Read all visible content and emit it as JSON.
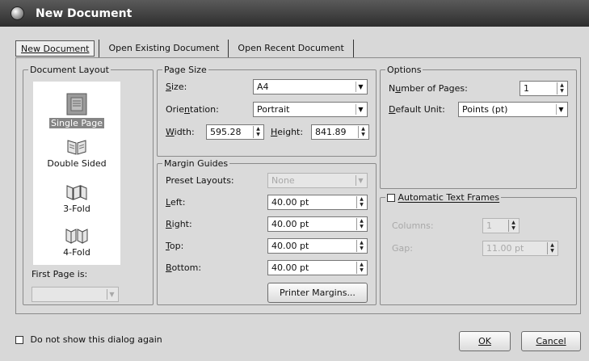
{
  "window": {
    "title": "New Document"
  },
  "tabs": [
    {
      "label": "New Document"
    },
    {
      "label": "Open Existing Document"
    },
    {
      "label": "Open Recent Document"
    }
  ],
  "document_layout": {
    "legend": "Document Layout",
    "items": [
      {
        "label": "Single Page"
      },
      {
        "label": "Double Sided"
      },
      {
        "label": "3-Fold"
      },
      {
        "label": "4-Fold"
      }
    ],
    "selected": "Single Page",
    "first_page_label": "First Page is:",
    "first_page_value": ""
  },
  "page_size": {
    "legend": "Page Size",
    "size_label": "Size:",
    "size_value": "A4",
    "orientation_label": "Orientation:",
    "orientation_value": "Portrait",
    "width_label": "Width:",
    "width_value": "595.28",
    "height_label": "Height:",
    "height_value": "841.89"
  },
  "margin_guides": {
    "legend": "Margin Guides",
    "preset_label": "Preset Layouts:",
    "preset_value": "None",
    "left_label": "Left:",
    "left_value": "40.00 pt",
    "right_label": "Right:",
    "right_value": "40.00 pt",
    "top_label": "Top:",
    "top_value": "40.00 pt",
    "bottom_label": "Bottom:",
    "bottom_value": "40.00 pt",
    "printer_button": "Printer Margins..."
  },
  "options": {
    "legend": "Options",
    "pages_label": "Number of Pages:",
    "pages_value": "1",
    "unit_label": "Default Unit:",
    "unit_value": "Points (pt)"
  },
  "auto_frames": {
    "label": "Automatic Text Frames",
    "checked": false,
    "columns_label": "Columns:",
    "columns_value": "1",
    "gap_label": "Gap:",
    "gap_value": "11.00 pt"
  },
  "footer": {
    "dont_show_label": "Do not show this dialog again",
    "ok_label": "OK",
    "cancel_label": "Cancel"
  }
}
